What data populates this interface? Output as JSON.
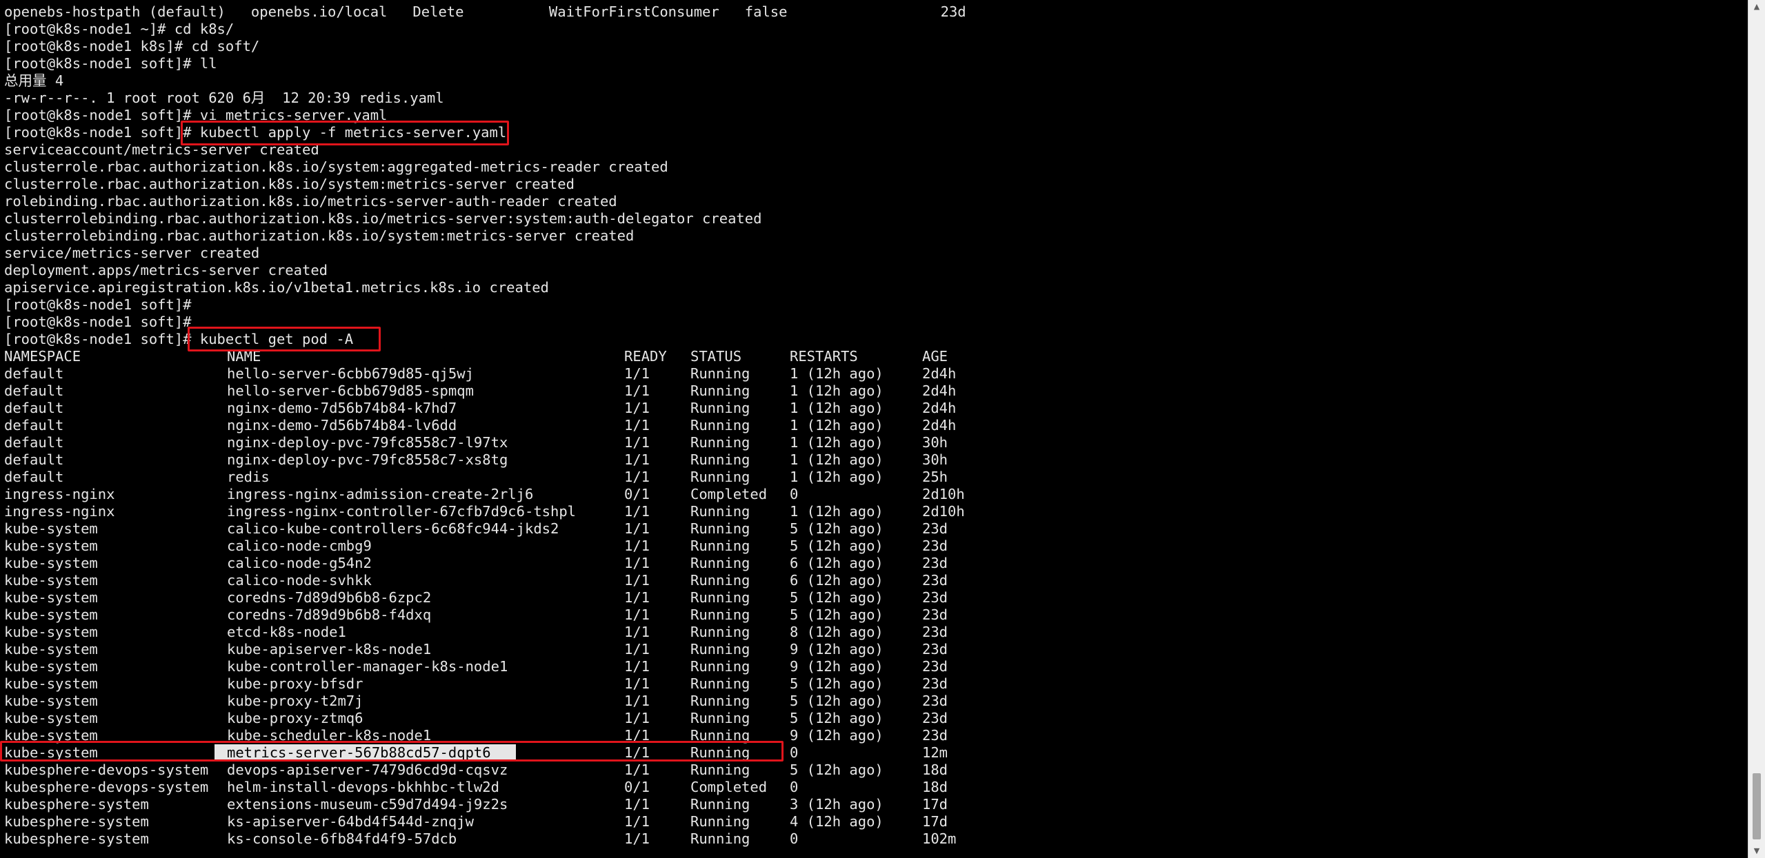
{
  "prompt": "[root@k8s-node1 soft]#",
  "lines": {
    "l0": "openebs-hostpath (default)   openebs.io/local   Delete          WaitForFirstConsumer   false                  23d",
    "l1": "[root@k8s-node1 ~]# cd k8s/",
    "l2": "[root@k8s-node1 k8s]# cd soft/",
    "l3": "[root@k8s-node1 soft]# ll",
    "l4": "总用量 4",
    "l5": "-rw-r--r--. 1 root root 620 6月  12 20:39 redis.yaml",
    "l6": "[root@k8s-node1 soft]# vi metrics-server.yaml",
    "l7_prompt": "[root@k8s-node1 soft]# ",
    "l7_cmd": "kubectl apply -f metrics-server.yaml",
    "l8": "serviceaccount/metrics-server created",
    "l9": "clusterrole.rbac.authorization.k8s.io/system:aggregated-metrics-reader created",
    "l10": "clusterrole.rbac.authorization.k8s.io/system:metrics-server created",
    "l11": "rolebinding.rbac.authorization.k8s.io/metrics-server-auth-reader created",
    "l12": "clusterrolebinding.rbac.authorization.k8s.io/metrics-server:system:auth-delegator created",
    "l13": "clusterrolebinding.rbac.authorization.k8s.io/system:metrics-server created",
    "l14": "service/metrics-server created",
    "l15": "deployment.apps/metrics-server created",
    "l16": "apiservice.apiregistration.k8s.io/v1beta1.metrics.k8s.io created",
    "l17": "[root@k8s-node1 soft]#",
    "l18": "[root@k8s-node1 soft]#",
    "l19_prompt": "[root@k8s-node1 soft]# ",
    "l19_cmd": "kubectl get pod -A"
  },
  "table": {
    "headers": [
      "NAMESPACE",
      "NAME",
      "READY",
      "STATUS",
      "RESTARTS",
      "AGE"
    ],
    "rows": [
      [
        "default",
        "hello-server-6cbb679d85-qj5wj",
        "1/1",
        "Running",
        "1 (12h ago)",
        "2d4h"
      ],
      [
        "default",
        "hello-server-6cbb679d85-spmqm",
        "1/1",
        "Running",
        "1 (12h ago)",
        "2d4h"
      ],
      [
        "default",
        "nginx-demo-7d56b74b84-k7hd7",
        "1/1",
        "Running",
        "1 (12h ago)",
        "2d4h"
      ],
      [
        "default",
        "nginx-demo-7d56b74b84-lv6dd",
        "1/1",
        "Running",
        "1 (12h ago)",
        "2d4h"
      ],
      [
        "default",
        "nginx-deploy-pvc-79fc8558c7-l97tx",
        "1/1",
        "Running",
        "1 (12h ago)",
        "30h"
      ],
      [
        "default",
        "nginx-deploy-pvc-79fc8558c7-xs8tg",
        "1/1",
        "Running",
        "1 (12h ago)",
        "30h"
      ],
      [
        "default",
        "redis",
        "1/1",
        "Running",
        "1 (12h ago)",
        "25h"
      ],
      [
        "ingress-nginx",
        "ingress-nginx-admission-create-2rlj6",
        "0/1",
        "Completed",
        "0",
        "2d10h"
      ],
      [
        "ingress-nginx",
        "ingress-nginx-controller-67cfb7d9c6-tshpl",
        "1/1",
        "Running",
        "1 (12h ago)",
        "2d10h"
      ],
      [
        "kube-system",
        "calico-kube-controllers-6c68fc944-jkds2",
        "1/1",
        "Running",
        "5 (12h ago)",
        "23d"
      ],
      [
        "kube-system",
        "calico-node-cmbg9",
        "1/1",
        "Running",
        "5 (12h ago)",
        "23d"
      ],
      [
        "kube-system",
        "calico-node-g54n2",
        "1/1",
        "Running",
        "6 (12h ago)",
        "23d"
      ],
      [
        "kube-system",
        "calico-node-svhkk",
        "1/1",
        "Running",
        "6 (12h ago)",
        "23d"
      ],
      [
        "kube-system",
        "coredns-7d89d9b6b8-6zpc2",
        "1/1",
        "Running",
        "5 (12h ago)",
        "23d"
      ],
      [
        "kube-system",
        "coredns-7d89d9b6b8-f4dxq",
        "1/1",
        "Running",
        "5 (12h ago)",
        "23d"
      ],
      [
        "kube-system",
        "etcd-k8s-node1",
        "1/1",
        "Running",
        "8 (12h ago)",
        "23d"
      ],
      [
        "kube-system",
        "kube-apiserver-k8s-node1",
        "1/1",
        "Running",
        "9 (12h ago)",
        "23d"
      ],
      [
        "kube-system",
        "kube-controller-manager-k8s-node1",
        "1/1",
        "Running",
        "9 (12h ago)",
        "23d"
      ],
      [
        "kube-system",
        "kube-proxy-bfsdr",
        "1/1",
        "Running",
        "5 (12h ago)",
        "23d"
      ],
      [
        "kube-system",
        "kube-proxy-t2m7j",
        "1/1",
        "Running",
        "5 (12h ago)",
        "23d"
      ],
      [
        "kube-system",
        "kube-proxy-ztmq6",
        "1/1",
        "Running",
        "5 (12h ago)",
        "23d"
      ],
      [
        "kube-system",
        "kube-scheduler-k8s-node1",
        "1/1",
        "Running",
        "9 (12h ago)",
        "23d"
      ],
      [
        "kube-system",
        "metrics-server-567b88cd57-dqpt6",
        "1/1",
        "Running",
        "0",
        "12m"
      ],
      [
        "kubesphere-devops-system",
        "devops-apiserver-7479d6cd9d-cqsvz",
        "1/1",
        "Running",
        "5 (12h ago)",
        "18d"
      ],
      [
        "kubesphere-devops-system",
        "helm-install-devops-bkhhbc-tlw2d",
        "0/1",
        "Completed",
        "0",
        "18d"
      ],
      [
        "kubesphere-system",
        "extensions-museum-c59d7d494-j9z2s",
        "1/1",
        "Running",
        "3 (12h ago)",
        "17d"
      ],
      [
        "kubesphere-system",
        "ks-apiserver-64bd4f544d-znqjw",
        "1/1",
        "Running",
        "4 (12h ago)",
        "17d"
      ],
      [
        "kubesphere-system",
        "ks-console-6fb84fd4f9-57dcb",
        "1/1",
        "Running",
        "0",
        "102m"
      ]
    ]
  },
  "highlight_color": "#e0141b",
  "scrollbar": {
    "up_icon": "▲",
    "down_icon": "▼"
  }
}
